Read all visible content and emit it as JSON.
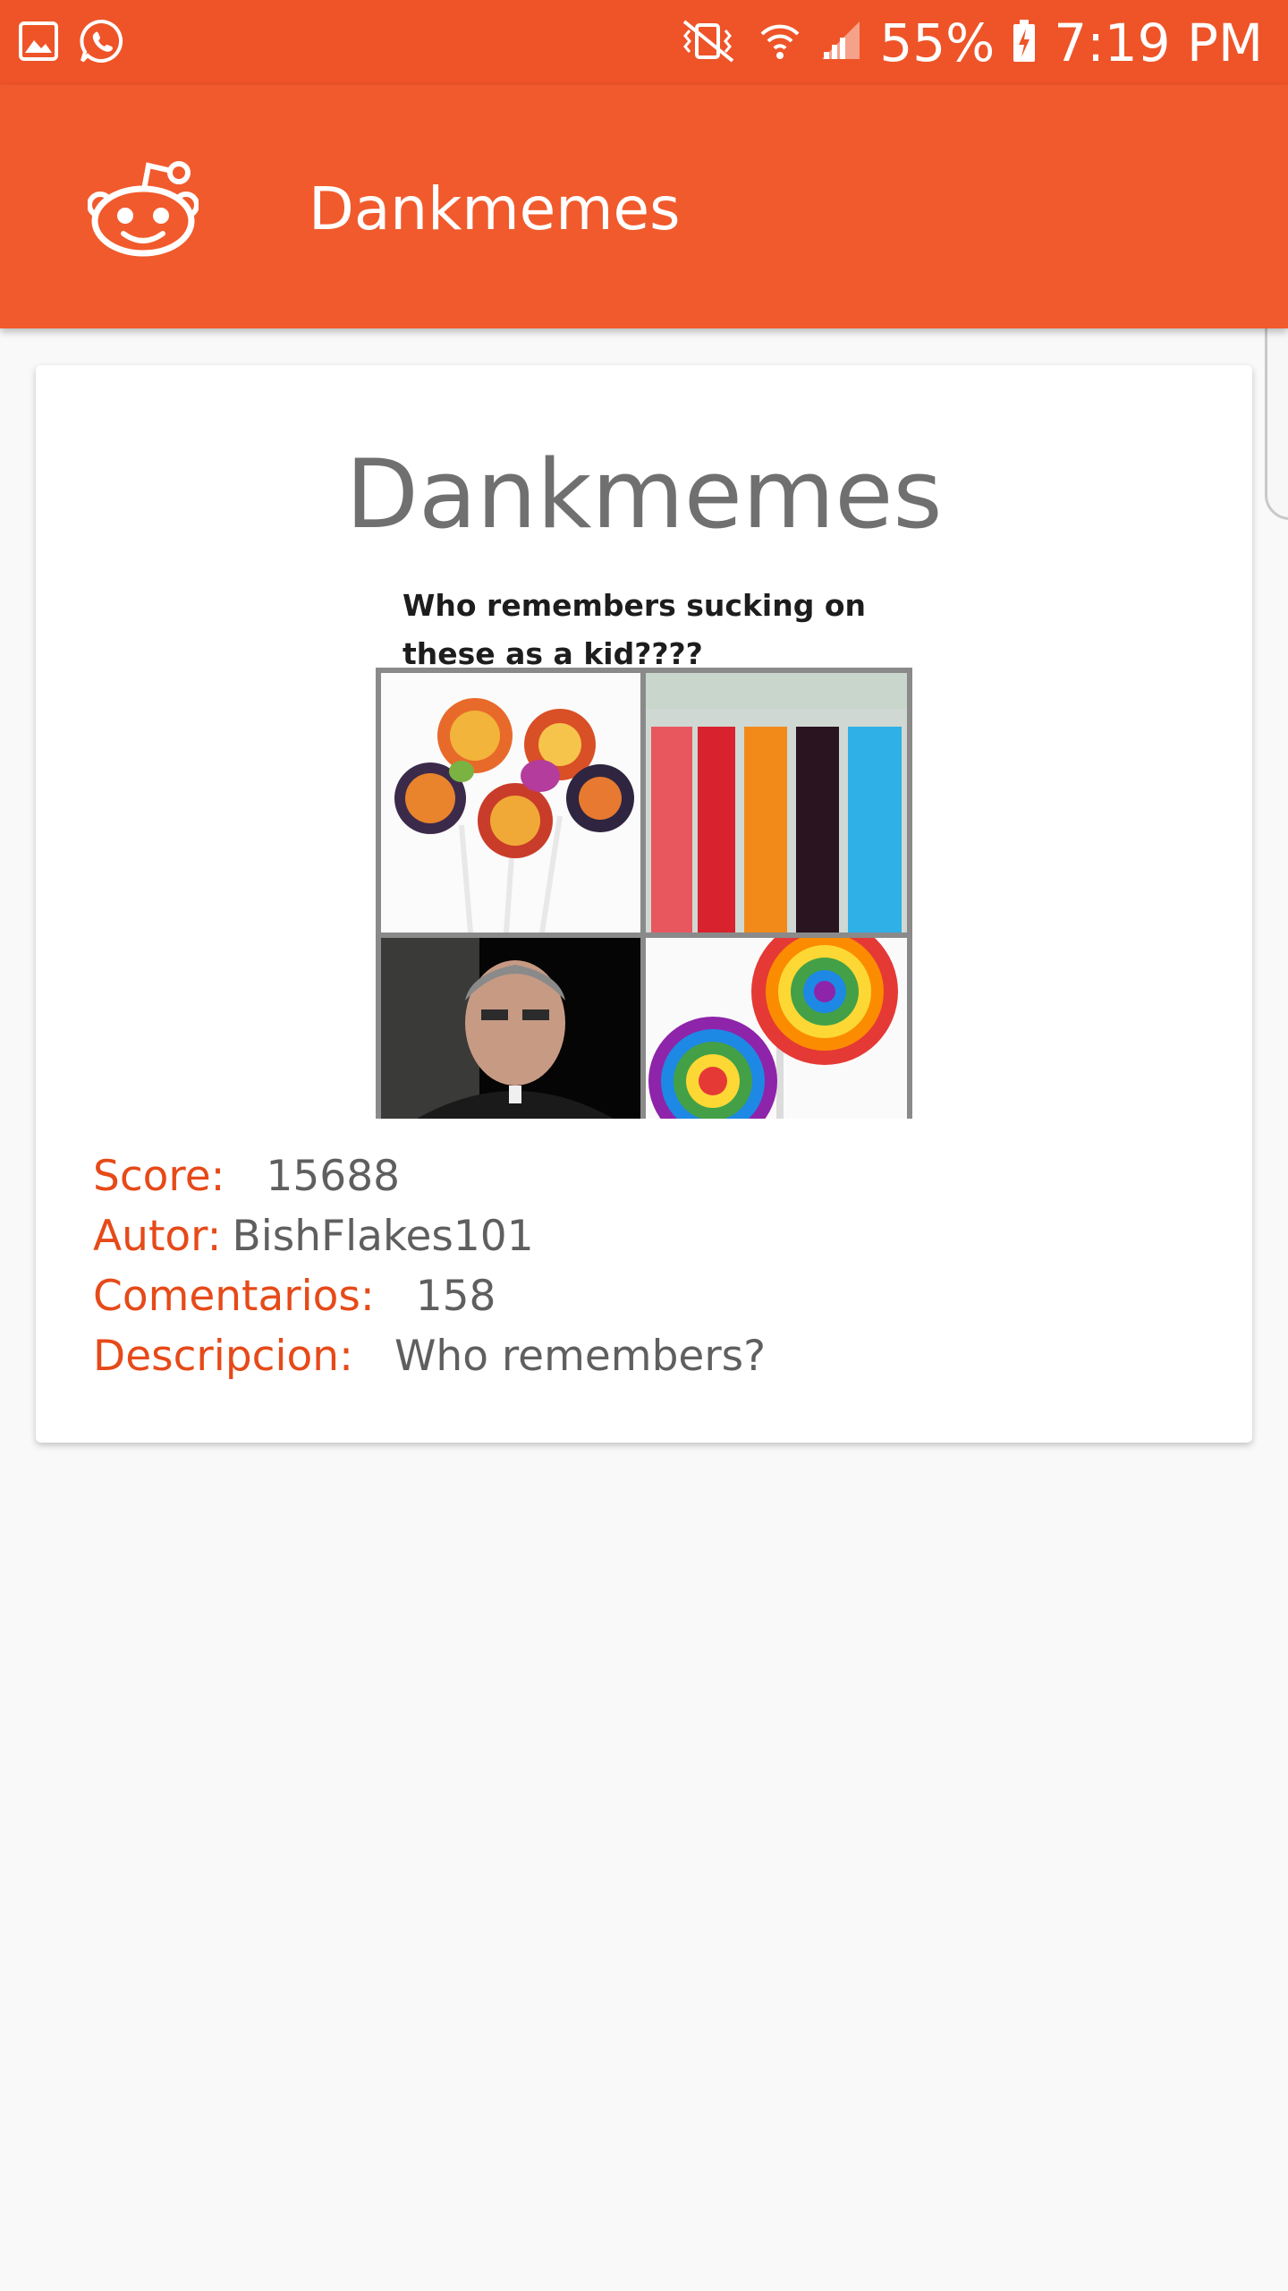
{
  "status_bar": {
    "battery": "55%",
    "time": "7:19 PM",
    "left_icons": [
      "image-icon",
      "whatsapp-icon"
    ],
    "right_icons": [
      "vibrate-mute-icon",
      "wifi-icon",
      "signal-icon",
      "battery-charging-icon"
    ]
  },
  "app_bar": {
    "title": "Dankmemes",
    "logo_icon": "reddit-alien-icon"
  },
  "post": {
    "title": "Dankmemes",
    "image_caption": "Who remembers sucking on these as a kid????",
    "score_label": "Score:",
    "score_value": "15688",
    "author_label": "Autor:",
    "author_value": "BishFlakes101",
    "comments_label": "Comentarios:",
    "comments_value": "158",
    "description_label": "Descripcion:",
    "description_value": "Who remembers?"
  },
  "colors": {
    "status_bar": "#ee5428",
    "app_bar": "#f15a2c",
    "label": "#e64a19",
    "value": "#5f5f5f",
    "background": "#f9f9f9"
  }
}
